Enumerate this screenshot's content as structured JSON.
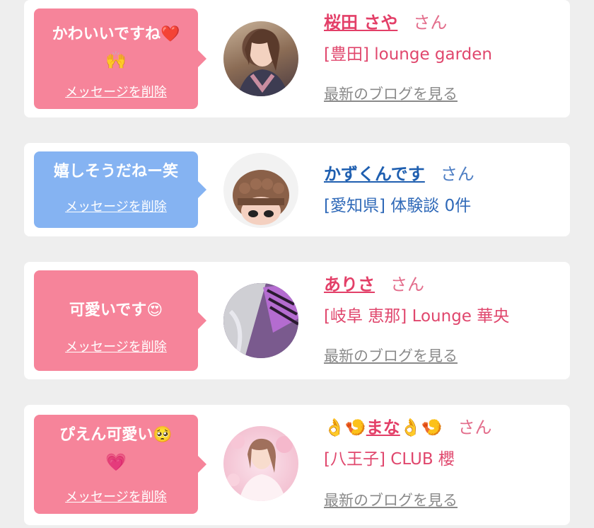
{
  "items": [
    {
      "message": "かわいいですね",
      "message_emoji": "❤️",
      "message_emoji2": "🙌",
      "delete_label": "メッセージを削除",
      "name": "桜田 さや",
      "honorific": "さん",
      "shop": "[豊田] lounge garden",
      "blog_label": "最新のブログを見る",
      "theme": "pink"
    },
    {
      "message": "嬉しそうだねー笑",
      "delete_label": "メッセージを削除",
      "name": "かずくんです",
      "honorific": "さん",
      "shop": "[愛知県] 体験談 0件",
      "theme": "blue"
    },
    {
      "message": "可愛いです",
      "message_emoji": "😍",
      "delete_label": "メッセージを削除",
      "name": "ありさ",
      "honorific": "さん",
      "shop": "[岐阜 恵那] Lounge 華央",
      "blog_label": "最新のブログを見る",
      "theme": "pink"
    },
    {
      "message": "ぴえん可愛い",
      "message_emoji": "🥺",
      "message_emoji2": "💗",
      "delete_label": "メッセージを削除",
      "name_prefix_emoji": "👌🍤",
      "name": "まな",
      "name_suffix_emoji": "👌🍤",
      "honorific": "さん",
      "shop": "[八王子] CLUB 櫻",
      "blog_label": "最新のブログを見る",
      "theme": "pink"
    }
  ]
}
